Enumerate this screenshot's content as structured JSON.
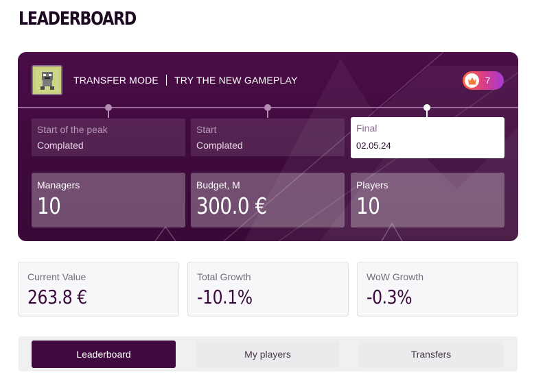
{
  "page": {
    "title": "LEADERBOARD"
  },
  "hero": {
    "mode_label": "TRANSFER MODE",
    "mode_tagline": "TRY THE NEW GAMEPLAY",
    "rank_badge": {
      "icon": "crown-icon",
      "value": "7"
    },
    "stages": [
      {
        "label": "Start of the peak",
        "value": "Complated",
        "active": false
      },
      {
        "label": "Start",
        "value": "Complated",
        "active": false
      },
      {
        "label": "Final",
        "value": "02.05.24",
        "active": true
      }
    ],
    "stats": [
      {
        "label": "Managers",
        "value": "10"
      },
      {
        "label": "Budget, M",
        "value": "300.0 €"
      },
      {
        "label": "Players",
        "value": "10"
      }
    ]
  },
  "kpis": [
    {
      "label": "Current Value",
      "value": "263.8 €"
    },
    {
      "label": "Total Growth",
      "value": "-10.1%"
    },
    {
      "label": "WoW Growth",
      "value": "-0.3%"
    }
  ],
  "tabs": [
    {
      "label": "Leaderboard",
      "active": true
    },
    {
      "label": "My players",
      "active": false
    },
    {
      "label": "Transfers",
      "active": false
    }
  ],
  "colors": {
    "hero_bg": "#3e0a3c",
    "active_tab": "#3f0a3f",
    "badge_gradient_start": "#ff6a3c",
    "badge_gradient_end": "#a53ad6"
  }
}
